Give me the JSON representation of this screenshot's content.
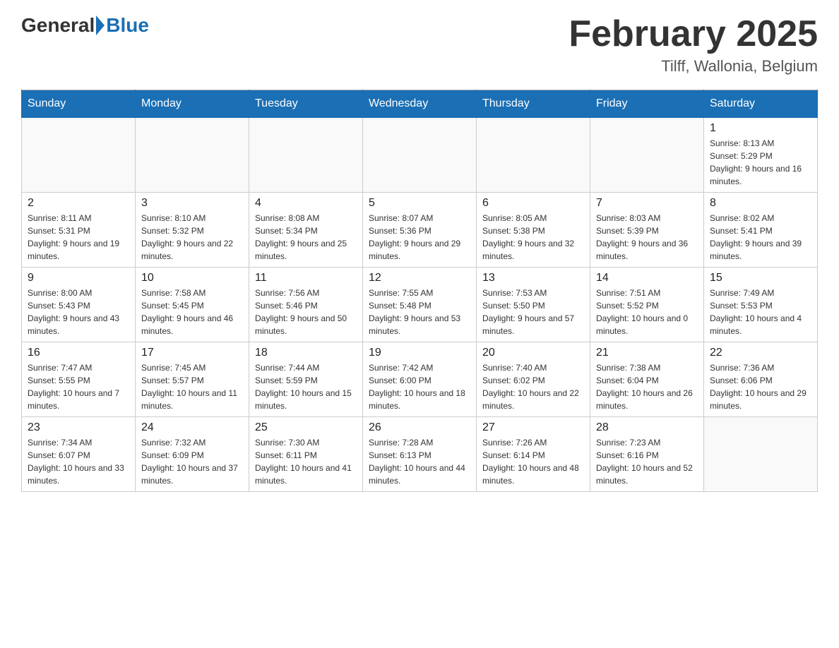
{
  "header": {
    "logo_general": "General",
    "logo_blue": "Blue",
    "title": "February 2025",
    "location": "Tilff, Wallonia, Belgium"
  },
  "days_of_week": [
    "Sunday",
    "Monday",
    "Tuesday",
    "Wednesday",
    "Thursday",
    "Friday",
    "Saturday"
  ],
  "weeks": [
    [
      {
        "day": "",
        "info": ""
      },
      {
        "day": "",
        "info": ""
      },
      {
        "day": "",
        "info": ""
      },
      {
        "day": "",
        "info": ""
      },
      {
        "day": "",
        "info": ""
      },
      {
        "day": "",
        "info": ""
      },
      {
        "day": "1",
        "info": "Sunrise: 8:13 AM\nSunset: 5:29 PM\nDaylight: 9 hours and 16 minutes."
      }
    ],
    [
      {
        "day": "2",
        "info": "Sunrise: 8:11 AM\nSunset: 5:31 PM\nDaylight: 9 hours and 19 minutes."
      },
      {
        "day": "3",
        "info": "Sunrise: 8:10 AM\nSunset: 5:32 PM\nDaylight: 9 hours and 22 minutes."
      },
      {
        "day": "4",
        "info": "Sunrise: 8:08 AM\nSunset: 5:34 PM\nDaylight: 9 hours and 25 minutes."
      },
      {
        "day": "5",
        "info": "Sunrise: 8:07 AM\nSunset: 5:36 PM\nDaylight: 9 hours and 29 minutes."
      },
      {
        "day": "6",
        "info": "Sunrise: 8:05 AM\nSunset: 5:38 PM\nDaylight: 9 hours and 32 minutes."
      },
      {
        "day": "7",
        "info": "Sunrise: 8:03 AM\nSunset: 5:39 PM\nDaylight: 9 hours and 36 minutes."
      },
      {
        "day": "8",
        "info": "Sunrise: 8:02 AM\nSunset: 5:41 PM\nDaylight: 9 hours and 39 minutes."
      }
    ],
    [
      {
        "day": "9",
        "info": "Sunrise: 8:00 AM\nSunset: 5:43 PM\nDaylight: 9 hours and 43 minutes."
      },
      {
        "day": "10",
        "info": "Sunrise: 7:58 AM\nSunset: 5:45 PM\nDaylight: 9 hours and 46 minutes."
      },
      {
        "day": "11",
        "info": "Sunrise: 7:56 AM\nSunset: 5:46 PM\nDaylight: 9 hours and 50 minutes."
      },
      {
        "day": "12",
        "info": "Sunrise: 7:55 AM\nSunset: 5:48 PM\nDaylight: 9 hours and 53 minutes."
      },
      {
        "day": "13",
        "info": "Sunrise: 7:53 AM\nSunset: 5:50 PM\nDaylight: 9 hours and 57 minutes."
      },
      {
        "day": "14",
        "info": "Sunrise: 7:51 AM\nSunset: 5:52 PM\nDaylight: 10 hours and 0 minutes."
      },
      {
        "day": "15",
        "info": "Sunrise: 7:49 AM\nSunset: 5:53 PM\nDaylight: 10 hours and 4 minutes."
      }
    ],
    [
      {
        "day": "16",
        "info": "Sunrise: 7:47 AM\nSunset: 5:55 PM\nDaylight: 10 hours and 7 minutes."
      },
      {
        "day": "17",
        "info": "Sunrise: 7:45 AM\nSunset: 5:57 PM\nDaylight: 10 hours and 11 minutes."
      },
      {
        "day": "18",
        "info": "Sunrise: 7:44 AM\nSunset: 5:59 PM\nDaylight: 10 hours and 15 minutes."
      },
      {
        "day": "19",
        "info": "Sunrise: 7:42 AM\nSunset: 6:00 PM\nDaylight: 10 hours and 18 minutes."
      },
      {
        "day": "20",
        "info": "Sunrise: 7:40 AM\nSunset: 6:02 PM\nDaylight: 10 hours and 22 minutes."
      },
      {
        "day": "21",
        "info": "Sunrise: 7:38 AM\nSunset: 6:04 PM\nDaylight: 10 hours and 26 minutes."
      },
      {
        "day": "22",
        "info": "Sunrise: 7:36 AM\nSunset: 6:06 PM\nDaylight: 10 hours and 29 minutes."
      }
    ],
    [
      {
        "day": "23",
        "info": "Sunrise: 7:34 AM\nSunset: 6:07 PM\nDaylight: 10 hours and 33 minutes."
      },
      {
        "day": "24",
        "info": "Sunrise: 7:32 AM\nSunset: 6:09 PM\nDaylight: 10 hours and 37 minutes."
      },
      {
        "day": "25",
        "info": "Sunrise: 7:30 AM\nSunset: 6:11 PM\nDaylight: 10 hours and 41 minutes."
      },
      {
        "day": "26",
        "info": "Sunrise: 7:28 AM\nSunset: 6:13 PM\nDaylight: 10 hours and 44 minutes."
      },
      {
        "day": "27",
        "info": "Sunrise: 7:26 AM\nSunset: 6:14 PM\nDaylight: 10 hours and 48 minutes."
      },
      {
        "day": "28",
        "info": "Sunrise: 7:23 AM\nSunset: 6:16 PM\nDaylight: 10 hours and 52 minutes."
      },
      {
        "day": "",
        "info": ""
      }
    ]
  ]
}
